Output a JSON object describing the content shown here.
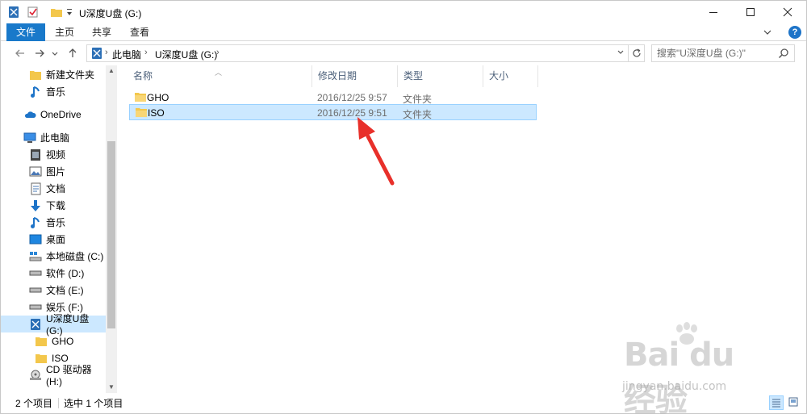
{
  "titlebar": {
    "title": "U深度U盘 (G:)",
    "minimize": "—",
    "maximize": "☐",
    "close": "✕"
  },
  "ribbon": {
    "tabs": [
      {
        "label": "文件",
        "active": true
      },
      {
        "label": "主页"
      },
      {
        "label": "共享"
      },
      {
        "label": "查看"
      }
    ],
    "help": "?"
  },
  "nav": {
    "breadcrumbs": [
      "此电脑",
      "U深度U盘 (G:)"
    ],
    "search_placeholder": "搜索\"U深度U盘 (G:)\""
  },
  "sidebar": {
    "items": [
      {
        "label": "新建文件夹",
        "icon": "folder-icon"
      },
      {
        "label": "音乐",
        "icon": "music-icon"
      },
      {
        "label": "OneDrive",
        "icon": "cloud-icon"
      },
      {
        "label": "此电脑",
        "icon": "computer-icon"
      },
      {
        "label": "视频",
        "icon": "video-icon"
      },
      {
        "label": "图片",
        "icon": "picture-icon"
      },
      {
        "label": "文档",
        "icon": "document-icon"
      },
      {
        "label": "下载",
        "icon": "download-icon"
      },
      {
        "label": "音乐",
        "icon": "music-icon"
      },
      {
        "label": "桌面",
        "icon": "desktop-icon"
      },
      {
        "label": "本地磁盘 (C:)",
        "icon": "system-drive-icon"
      },
      {
        "label": "软件 (D:)",
        "icon": "drive-icon"
      },
      {
        "label": "文档 (E:)",
        "icon": "drive-icon"
      },
      {
        "label": "娱乐 (F:)",
        "icon": "drive-icon"
      },
      {
        "label": "U深度U盘 (G:)",
        "icon": "usb-drive-icon",
        "selected": true
      },
      {
        "label": "GHO",
        "icon": "folder-icon"
      },
      {
        "label": "ISO",
        "icon": "folder-icon"
      },
      {
        "label": "CD 驱动器 (H:)",
        "icon": "cd-drive-icon"
      }
    ]
  },
  "columns": {
    "name": "名称",
    "date": "修改日期",
    "type": "类型",
    "size": "大小"
  },
  "files": [
    {
      "name": "GHO",
      "date": "2016/12/25 9:57",
      "type": "文件夹",
      "size": ""
    },
    {
      "name": "ISO",
      "date": "2016/12/25 9:51",
      "type": "文件夹",
      "size": "",
      "selected": true
    }
  ],
  "status": {
    "count": "2 个项目",
    "selected": "选中 1 个项目"
  },
  "watermark": {
    "brand": "Bai du 经验",
    "url": "jingyan.baidu.com"
  },
  "colors": {
    "accent": "#1979ca",
    "selection": "#cce8ff",
    "selection_border": "#99d1ff",
    "folder": "#f3c74c",
    "annotation": "#e8302a"
  }
}
